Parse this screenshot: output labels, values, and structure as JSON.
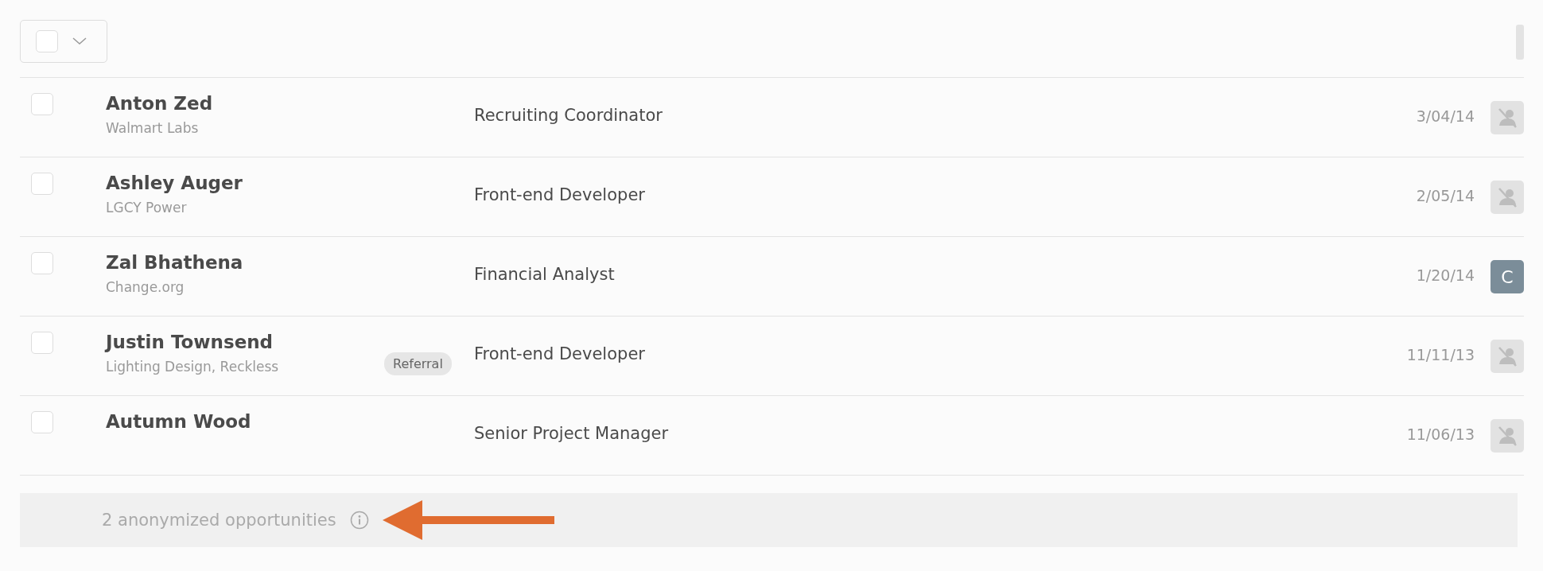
{
  "bulk_select": {
    "checked": false
  },
  "rows": [
    {
      "name": "Anton Zed",
      "company": "Walmart Labs",
      "role": "Recruiting Coordinator",
      "date": "3/04/14",
      "checked": false,
      "avatar": {
        "kind": "anonymous"
      }
    },
    {
      "name": "Ashley Auger",
      "company": "LGCY Power",
      "role": "Front-end Developer",
      "date": "2/05/14",
      "checked": false,
      "avatar": {
        "kind": "anonymous"
      }
    },
    {
      "name": "Zal Bhathena",
      "company": "Change.org",
      "role": "Financial Analyst",
      "date": "1/20/14",
      "checked": false,
      "avatar": {
        "kind": "initial",
        "text": "C"
      }
    },
    {
      "name": "Justin Townsend",
      "company": "Lighting Design, Reckless",
      "badge": "Referral",
      "role": "Front-end Developer",
      "date": "11/11/13",
      "checked": false,
      "avatar": {
        "kind": "anonymous"
      }
    },
    {
      "name": "Autumn Wood",
      "role": "Senior Project Manager",
      "date": "11/06/13",
      "checked": false,
      "avatar": {
        "kind": "anonymous"
      }
    }
  ],
  "footer": {
    "text": "2 anonymized opportunities"
  }
}
